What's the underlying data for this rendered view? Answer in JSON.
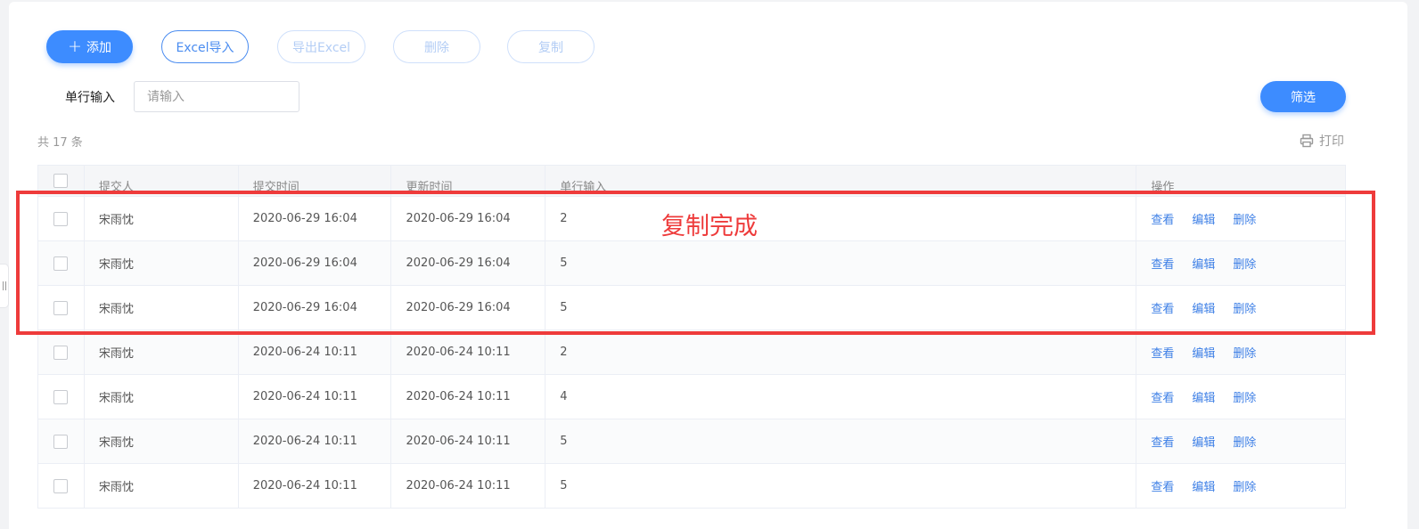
{
  "toolbar": {
    "add_label": "添加",
    "import_label": "Excel导入",
    "export_label": "导出Excel",
    "delete_label": "删除",
    "copy_label": "复制"
  },
  "filter": {
    "label": "单行输入",
    "placeholder": "请输入",
    "button_label": "筛选"
  },
  "summary": {
    "total": "共 17 条",
    "print_label": "打印"
  },
  "table": {
    "headers": [
      "提交人",
      "提交时间",
      "更新时间",
      "单行输入",
      "操作"
    ],
    "actions": [
      "查看",
      "编辑",
      "删除"
    ],
    "rows": [
      {
        "submitter": "宋雨忱",
        "submitted": "2020-06-29 16:04",
        "updated": "2020-06-29 16:04",
        "value": "2"
      },
      {
        "submitter": "宋雨忱",
        "submitted": "2020-06-29 16:04",
        "updated": "2020-06-29 16:04",
        "value": "5"
      },
      {
        "submitter": "宋雨忱",
        "submitted": "2020-06-29 16:04",
        "updated": "2020-06-29 16:04",
        "value": "5"
      },
      {
        "submitter": "宋雨忱",
        "submitted": "2020-06-24 10:11",
        "updated": "2020-06-24 10:11",
        "value": "2"
      },
      {
        "submitter": "宋雨忱",
        "submitted": "2020-06-24 10:11",
        "updated": "2020-06-24 10:11",
        "value": "4"
      },
      {
        "submitter": "宋雨忱",
        "submitted": "2020-06-24 10:11",
        "updated": "2020-06-24 10:11",
        "value": "5"
      },
      {
        "submitter": "宋雨忱",
        "submitted": "2020-06-24 10:11",
        "updated": "2020-06-24 10:11",
        "value": "5"
      }
    ]
  },
  "annotation": {
    "text": "复制完成"
  },
  "colors": {
    "primary": "#3d8cff",
    "link": "#3d7fe6",
    "highlight": "#ee3b3b"
  }
}
